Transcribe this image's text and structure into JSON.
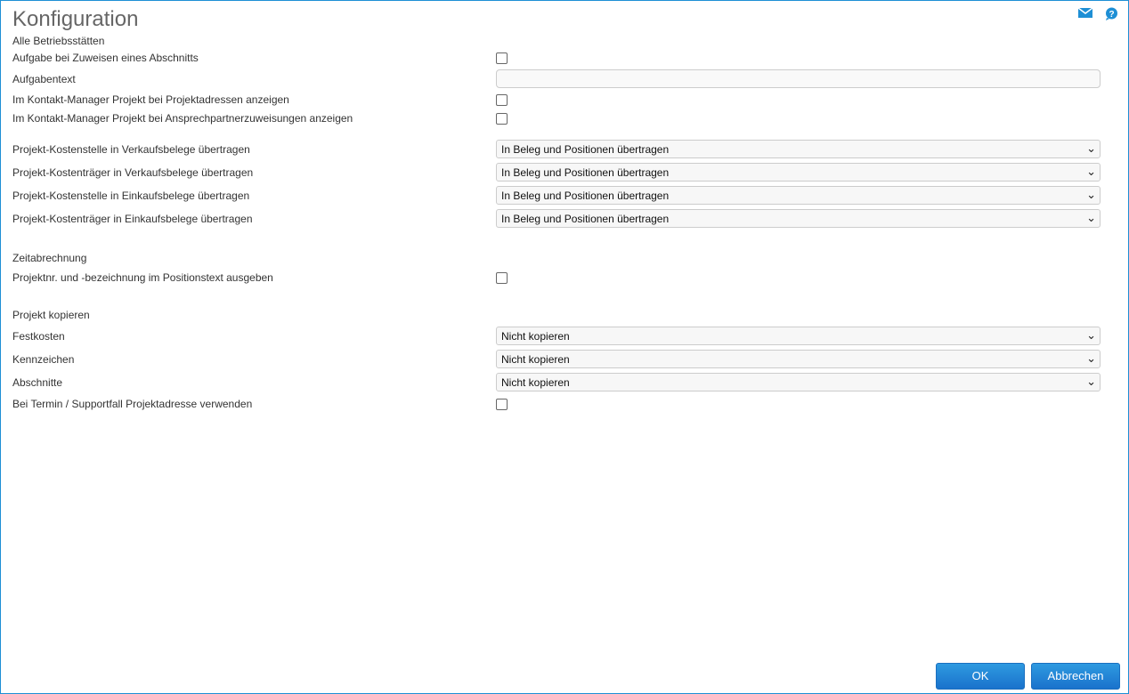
{
  "title": "Konfiguration",
  "icons": {
    "mail": "mail-icon",
    "help": "help-icon"
  },
  "sections": {
    "betrieb": "Alle Betriebsstätten",
    "zeit": "Zeitabrechnung",
    "kopieren": "Projekt kopieren"
  },
  "rows": {
    "aufgabe": "Aufgabe bei Zuweisen eines Abschnitts",
    "aufgabentext": "Aufgabentext",
    "aufgabentext_value": "",
    "km_adressen": "Im Kontakt-Manager Projekt bei Projektadressen anzeigen",
    "km_ansprech": "Im Kontakt-Manager Projekt bei Ansprechpartnerzuweisungen anzeigen",
    "ks_verkauf": "Projekt-Kostenstelle in Verkaufsbelege übertragen",
    "kt_verkauf": "Projekt-Kostenträger in Verkaufsbelege übertragen",
    "ks_einkauf": "Projekt-Kostenstelle in Einkaufsbelege übertragen",
    "kt_einkauf": "Projekt-Kostenträger in Einkaufsbelege übertragen",
    "projektnr": "Projektnr. und -bezeichnung im Positionstext ausgeben",
    "festkosten": "Festkosten",
    "kennzeichen": "Kennzeichen",
    "abschnitte": "Abschnitte",
    "termin": "Bei Termin / Supportfall Projektadresse verwenden"
  },
  "values": {
    "ks_verkauf": "In Beleg und Positionen übertragen",
    "kt_verkauf": "In Beleg und Positionen übertragen",
    "ks_einkauf": "In Beleg und Positionen übertragen",
    "kt_einkauf": "In Beleg und Positionen übertragen",
    "festkosten": "Nicht kopieren",
    "kennzeichen": "Nicht kopieren",
    "abschnitte": "Nicht kopieren"
  },
  "buttons": {
    "ok": "OK",
    "cancel": "Abbrechen"
  },
  "colors": {
    "accent": "#1e8fd5"
  }
}
